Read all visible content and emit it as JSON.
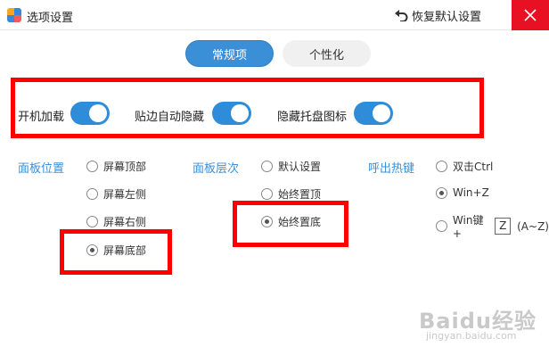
{
  "window": {
    "title": "选项设置",
    "restore_label": "恢复默认设置"
  },
  "tabs": [
    {
      "label": "常规项",
      "active": true
    },
    {
      "label": "个性化",
      "active": false
    }
  ],
  "toggles": [
    {
      "label": "开机加载",
      "on": true
    },
    {
      "label": "贴边自动隐藏",
      "on": true
    },
    {
      "label": "隐藏托盘图标",
      "on": true
    }
  ],
  "panel_position": {
    "title": "面板位置",
    "options": [
      {
        "label": "屏幕顶部",
        "selected": false
      },
      {
        "label": "屏幕左侧",
        "selected": false
      },
      {
        "label": "屏幕右侧",
        "selected": false
      },
      {
        "label": "屏幕底部",
        "selected": true
      }
    ]
  },
  "panel_layer": {
    "title": "面板层次",
    "options": [
      {
        "label": "默认设置",
        "selected": false
      },
      {
        "label": "始终置顶",
        "selected": false
      },
      {
        "label": "始终置底",
        "selected": true
      }
    ]
  },
  "hotkey": {
    "title": "呼出热键",
    "options": [
      {
        "label": "双击Ctrl",
        "selected": false
      },
      {
        "label": "Win+Z",
        "selected": true
      },
      {
        "label": "Win键+",
        "selected": false,
        "key": "Z",
        "range": "(A~Z)"
      }
    ]
  },
  "watermark": {
    "main": "Baidu经验",
    "sub": "jingyan.baidu.com"
  },
  "colors": {
    "accent": "#3b8fd7",
    "highlight": "#ff0000",
    "close": "#e81123"
  }
}
